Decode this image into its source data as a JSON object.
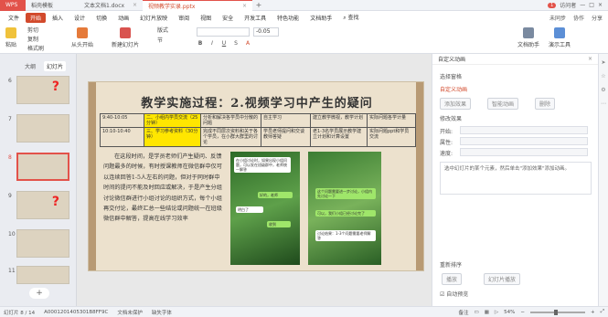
{
  "tabs": [
    {
      "label": "WPS",
      "kind": "first"
    },
    {
      "label": "稻壳模板",
      "kind": "doc"
    },
    {
      "label": "文本文档1.docx",
      "kind": "doc"
    },
    {
      "label": "视频教学实录.pptx",
      "kind": "active"
    }
  ],
  "window": {
    "badge": "1",
    "user": "访问者"
  },
  "menu": {
    "file": "文件",
    "items": [
      "开始",
      "插入",
      "设计",
      "切换",
      "动画",
      "幻灯片放映",
      "审阅",
      "视图",
      "安全",
      "开发工具",
      "特色功能",
      "文档助手"
    ],
    "search": "查找",
    "right": [
      "未同步",
      "协作",
      "分享"
    ]
  },
  "ribbon": {
    "paste": "粘贴",
    "cut": "剪切",
    "copy": "复制",
    "format": "格式刷",
    "new_slide": "新建幻灯片",
    "layout": "版式",
    "section": "节",
    "font_size": "-0.05",
    "from_start": "从头开始",
    "doc_assistant": "文档助手",
    "show_tool": "演示工具"
  },
  "left_panel": {
    "tab_outline": "大纲",
    "tab_slides": "幻灯片",
    "slide_numbers": [
      "6",
      "7",
      "8",
      "9",
      "10",
      "11"
    ],
    "selected": "8",
    "add": "+"
  },
  "slide": {
    "title": "教学实施过程：2.视频学习中产生的疑问",
    "rows": [
      [
        "9:40-10:05",
        "二、小组内学员交流（25分钟）",
        "分析和解决各学员中分散的问题",
        "自主学习",
        "建立教学微视，教学计划",
        "实际问题各学计量"
      ],
      [
        "10:10-10:40",
        "三、学习参考资料（30分钟）",
        "完成不同层次资料和关于各个学员，在小群大群里的讨论",
        "学员老师提问和交谈教师答疑",
        "老1-3名学员展示教学建立计划和计算设置",
        "实际问题ppt和学员交流"
      ]
    ],
    "body": "在这段时间，是学员老师们产生疑问、反馈问题最多的时候，有时授课教师在微信群中仅可以连续回答1-5人左右的问题，但对于同时群中时间的提问不能及时回应或解决，于是产生分组讨论微信群进行小组讨论的组织方式，每个小组再交付论，最终汇总一些结论或问题统一在班级微信群中解答，提高在线学习效率",
    "chat_left": [
      "在小组讨论时，如果出现小组问题，可以发在班级群中，老师统一解答",
      "好的，老师",
      "明白了",
      "收到"
    ],
    "chat_right": [
      "这个问题需要进一步讨论，小组内先讨论一下",
      "可以，我们小组已经讨论完了",
      "讨论结果：1-3个问题需要老师解答"
    ]
  },
  "right_panel": {
    "title": "自定义动画",
    "select_window": "选择窗格",
    "custom_anim": "自定义动画",
    "add_effect": "添加效果",
    "intelligent": "智能动画",
    "delete": "删除",
    "modify_label": "修改效果",
    "start_label": "开始:",
    "prop_label": "属性:",
    "speed_label": "速度:",
    "hint": "选中幻灯片的某个元素，然后单击\"添加效果\"添加动画。",
    "reorder": "重新排序",
    "play": "播放",
    "slideshow": "幻灯片播放",
    "auto_preview": "自动预览"
  },
  "status": {
    "slide_info": "幻灯片 8 / 14",
    "theme": "A0001201405301B8FF9C",
    "autocorrect": "文档未保护",
    "missing_font": "缺失字体",
    "notes": "备注",
    "zoom": "54%"
  }
}
